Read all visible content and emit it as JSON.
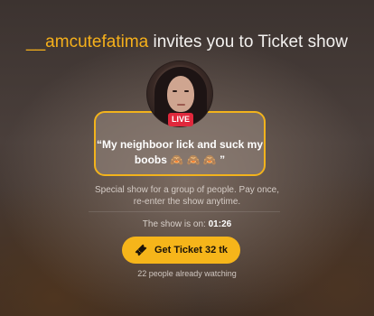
{
  "header": {
    "username": "__amcutefatima",
    "title_rest": " invites you to Ticket show"
  },
  "avatar": {
    "badge": "LIVE"
  },
  "quote": {
    "text": "“My neighboor lick and suck my boobs 🙈 🙈 🙈 ”"
  },
  "description": "Special show for a group of people. Pay once, re-enter the show anytime.",
  "timer": {
    "label": "The show is on: ",
    "value": "01:26"
  },
  "cta": {
    "label": "Get Ticket 32 tk",
    "icon": "ticket-icon"
  },
  "watching": "22 people already watching",
  "colors": {
    "accent": "#f6b51a",
    "live": "#e0283c"
  }
}
